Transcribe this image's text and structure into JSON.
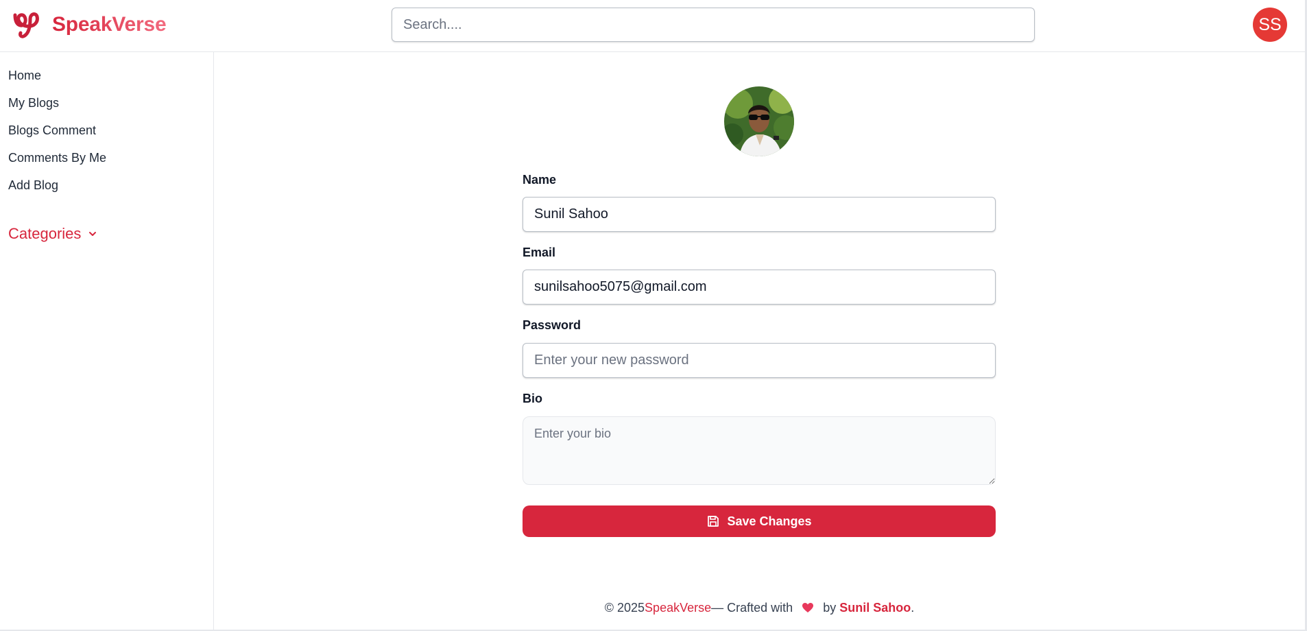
{
  "header": {
    "brand": "SpeakVerse",
    "search_placeholder": "Search....",
    "avatar_initials": "SS"
  },
  "sidebar": {
    "items": [
      {
        "label": "Home"
      },
      {
        "label": "My Blogs"
      },
      {
        "label": "Blogs Comment"
      },
      {
        "label": "Comments By Me"
      },
      {
        "label": "Add Blog"
      }
    ],
    "categories_label": "Categories"
  },
  "form": {
    "name_label": "Name",
    "name_value": "Sunil Sahoo",
    "email_label": "Email",
    "email_value": "sunilsahoo5075@gmail.com",
    "password_label": "Password",
    "password_placeholder": "Enter your new password",
    "bio_label": "Bio",
    "bio_placeholder": "Enter your bio",
    "save_label": "Save Changes"
  },
  "footer": {
    "copyright": "© 2025",
    "brand": "SpeakVerse",
    "crafted": "— Crafted with",
    "by": "by",
    "author": "Sunil Sahoo",
    "period": "."
  },
  "colors": {
    "accent": "#d7263d",
    "avatar_bg": "#e53935"
  }
}
